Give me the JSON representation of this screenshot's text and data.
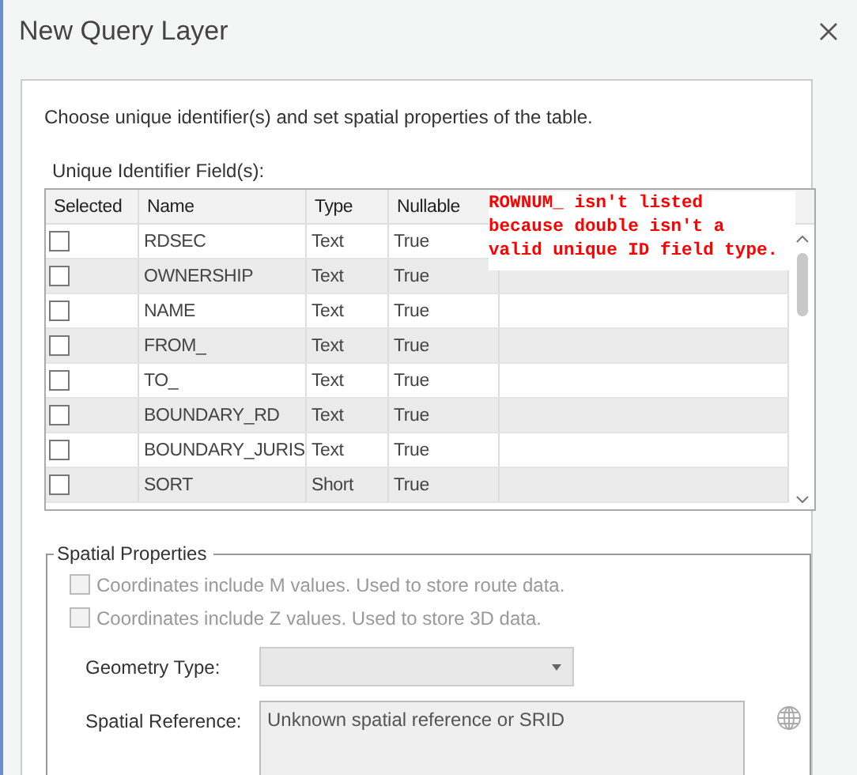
{
  "window": {
    "title": "New Query Layer"
  },
  "instruction": "Choose unique identifier(s) and set spatial properties of the table.",
  "unique_fields": {
    "label": "Unique Identifier Field(s):",
    "columns": [
      "Selected",
      "Name",
      "Type",
      "Nullable"
    ],
    "rows": [
      {
        "selected": false,
        "name": "RDSEC",
        "type": "Text",
        "nullable": "True"
      },
      {
        "selected": false,
        "name": "OWNERSHIP",
        "type": "Text",
        "nullable": "True"
      },
      {
        "selected": false,
        "name": "NAME",
        "type": "Text",
        "nullable": "True"
      },
      {
        "selected": false,
        "name": "FROM_",
        "type": "Text",
        "nullable": "True"
      },
      {
        "selected": false,
        "name": "TO_",
        "type": "Text",
        "nullable": "True"
      },
      {
        "selected": false,
        "name": "BOUNDARY_RD",
        "type": "Text",
        "nullable": "True"
      },
      {
        "selected": false,
        "name": "BOUNDARY_JURIS",
        "type": "Text",
        "nullable": "True"
      },
      {
        "selected": false,
        "name": "SORT",
        "type": "Short",
        "nullable": "True"
      }
    ]
  },
  "annotation": "ROWNUM_ isn't listed\nbecause double isn't a\nvalid unique ID field type.",
  "spatial": {
    "legend": "Spatial Properties",
    "options": [
      {
        "label": "Coordinates include M values. Used to store route data.",
        "checked": false,
        "disabled": true
      },
      {
        "label": "Coordinates include Z values. Used to store 3D data.",
        "checked": false,
        "disabled": true
      }
    ],
    "geometry_type": {
      "label": "Geometry Type:",
      "disabled": true
    },
    "spatial_reference": {
      "label": "Spatial Reference:",
      "value": "Unknown spatial reference or SRID"
    }
  }
}
